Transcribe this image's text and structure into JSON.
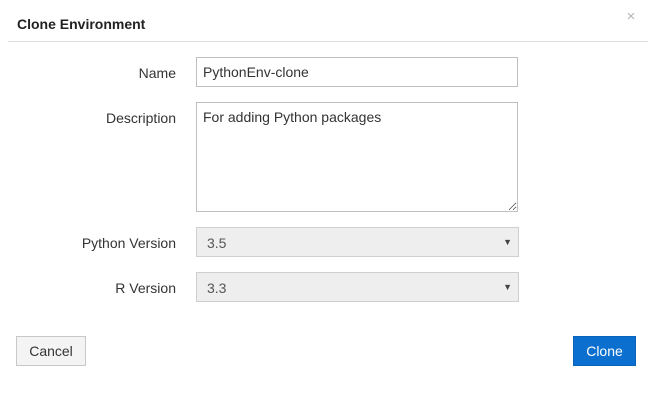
{
  "dialog": {
    "title": "Clone Environment",
    "close_glyph": "×",
    "close_icon": "close-icon"
  },
  "form": {
    "name": {
      "label": "Name",
      "value": "PythonEnv-clone"
    },
    "description": {
      "label": "Description",
      "value": "For adding Python packages"
    },
    "python_version": {
      "label": "Python Version",
      "selected": "3.5"
    },
    "r_version": {
      "label": "R Version",
      "selected": "3.3"
    },
    "caret_glyph": "▼",
    "caret_icon": "chevron-down-icon"
  },
  "buttons": {
    "cancel_label": "Cancel",
    "clone_label": "Clone"
  },
  "colors": {
    "primary": "#0b6fcf",
    "select_bg": "#eeeeee",
    "header_divider": "#dcdcdc"
  }
}
